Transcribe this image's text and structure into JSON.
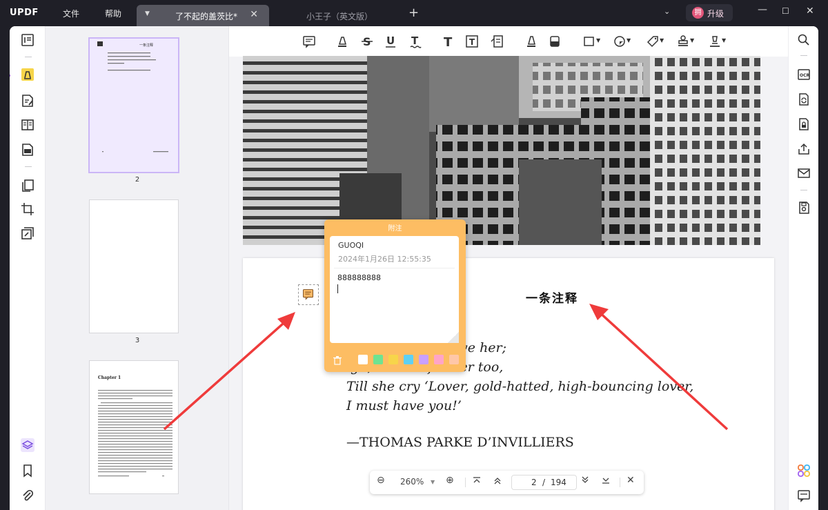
{
  "app": {
    "logo": "UPDF",
    "menu": [
      "文件",
      "帮助"
    ],
    "tabs": [
      {
        "title": "了不起的盖茨比*",
        "active": true
      },
      {
        "title": "小王子（英文版）",
        "active": false
      }
    ],
    "upgrade_icon": "拥",
    "upgrade_label": "升级"
  },
  "thumbnails": {
    "pages": [
      {
        "label": "2",
        "selected": true
      },
      {
        "label": "3",
        "selected": false
      },
      {
        "label": "",
        "selected": false
      }
    ],
    "thumb2_title": "一条注释",
    "thumb4_chapter": "Chapter 1"
  },
  "note": {
    "header": "附注",
    "author": "GUOQI",
    "date": "2024年1月26日 12:55:35",
    "content": "888888888",
    "colors": [
      "#ffffff",
      "#6fe391",
      "#f7d54a",
      "#5fd0f3",
      "#c9a0ff",
      "#ffa5c7",
      "#ffc7a8"
    ]
  },
  "document": {
    "note_title": "一条注释",
    "poem": [
      "at, if that will move her;",
      "igh, bounce for her too,",
      "Till she cry ‘Lover, gold-hatted, high-bouncing lover,",
      "I must have you!’"
    ],
    "signature": "—THOMAS PARKE D’INVILLIERS"
  },
  "zoom": {
    "level": "260%",
    "current_page": "2",
    "separator": "/",
    "total_pages": "194"
  },
  "colors": {
    "titlebar": "#1f1f27",
    "accent": "#a060f0",
    "note_orange": "#fdbd63",
    "arrow_red": "#ef3b3b"
  }
}
